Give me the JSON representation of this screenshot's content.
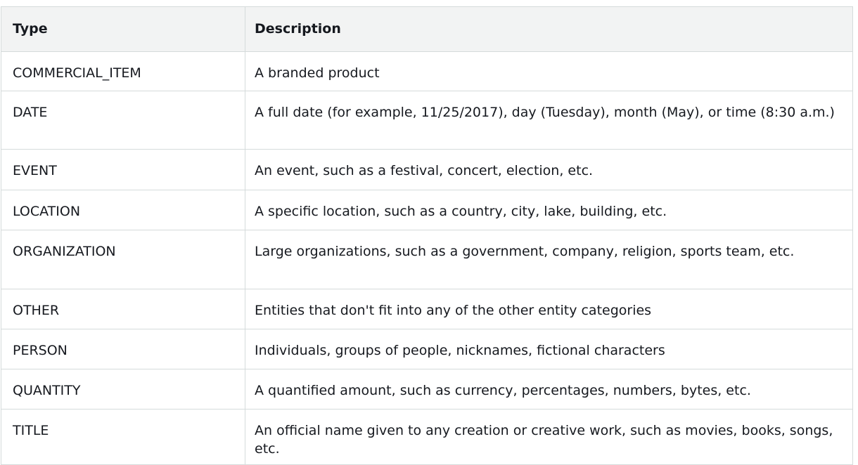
{
  "table": {
    "headers": {
      "type": "Type",
      "description": "Description"
    },
    "rows": [
      {
        "type": "COMMERCIAL_ITEM",
        "description": "A branded product"
      },
      {
        "type": "DATE",
        "description": "A full date (for example, 11/25/2017), day (Tuesday), month (May), or time (8:30 a.m.)"
      },
      {
        "type": "EVENT",
        "description": "An event, such as a festival, concert, election, etc."
      },
      {
        "type": "LOCATION",
        "description": "A specific location, such as a country, city, lake, building, etc."
      },
      {
        "type": "ORGANIZATION",
        "description": "Large organizations, such as a government, company, religion, sports team, etc."
      },
      {
        "type": "OTHER",
        "description": "Entities that don't fit into any of the other entity categories"
      },
      {
        "type": "PERSON",
        "description": "Individuals, groups of people, nicknames, fictional characters"
      },
      {
        "type": "QUANTITY",
        "description": "A quantified amount, such as currency, percentages, numbers, bytes, etc."
      },
      {
        "type": "TITLE",
        "description": "An official name given to any creation or creative work, such as movies, books, songs, etc."
      }
    ]
  }
}
